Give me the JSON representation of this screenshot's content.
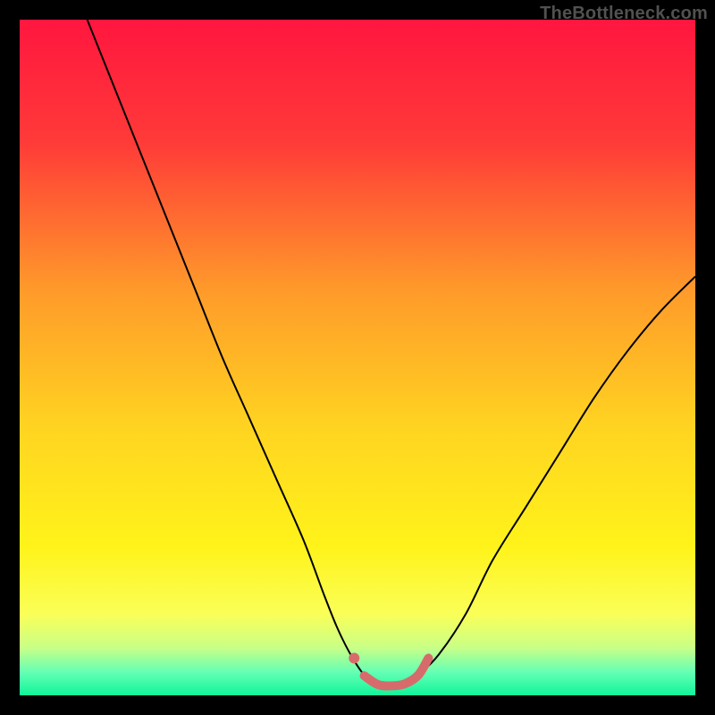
{
  "attribution": "TheBottleneck.com",
  "chart_data": {
    "type": "line",
    "title": "",
    "xlabel": "",
    "ylabel": "",
    "xlim": [
      0,
      100
    ],
    "ylim": [
      0,
      100
    ],
    "background_gradient": {
      "stops": [
        {
          "offset": 0.0,
          "color": "#ff163f"
        },
        {
          "offset": 0.18,
          "color": "#ff3a38"
        },
        {
          "offset": 0.4,
          "color": "#ff9a2a"
        },
        {
          "offset": 0.6,
          "color": "#ffd321"
        },
        {
          "offset": 0.78,
          "color": "#fff31a"
        },
        {
          "offset": 0.88,
          "color": "#faff58"
        },
        {
          "offset": 0.93,
          "color": "#c8ff88"
        },
        {
          "offset": 0.965,
          "color": "#66ffb4"
        },
        {
          "offset": 1.0,
          "color": "#10f59a"
        }
      ]
    },
    "series": [
      {
        "name": "bottleneck-curve",
        "color": "#000000",
        "stroke_width": 2,
        "x": [
          10,
          14,
          18,
          22,
          26,
          30,
          34,
          38,
          42,
          45,
          47,
          49,
          51,
          53,
          55,
          57,
          59,
          62,
          66,
          70,
          75,
          80,
          85,
          90,
          95,
          100
        ],
        "y": [
          100,
          90,
          80,
          70,
          60,
          50,
          41,
          32,
          23,
          15,
          10,
          6,
          3,
          1.5,
          1.2,
          1.5,
          3,
          6,
          12,
          20,
          28,
          36,
          44,
          51,
          57,
          62
        ]
      }
    ],
    "markers": {
      "color": "#d76b6b",
      "stroke_width": 10,
      "dot": {
        "x": 49.5,
        "y": 5.5,
        "r": 6
      },
      "flat_segment": {
        "x": [
          51,
          53,
          55,
          57,
          59,
          60.5
        ],
        "y": [
          2.9,
          1.6,
          1.4,
          1.7,
          3.0,
          5.5
        ]
      }
    }
  }
}
